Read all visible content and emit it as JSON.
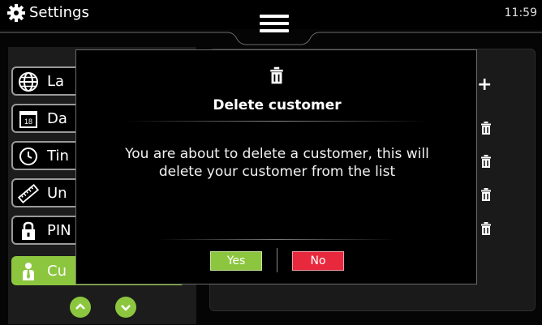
{
  "header": {
    "title": "Settings",
    "time": "11:59",
    "icon": "gear-icon",
    "menu_icon": "hamburger-menu-icon"
  },
  "sidebar": {
    "items": [
      {
        "label": "La",
        "icon": "globe-icon",
        "active": false
      },
      {
        "label": "Da",
        "icon": "calendar-icon",
        "calendar_day": "18",
        "active": false
      },
      {
        "label": "Tin",
        "icon": "clock-icon",
        "active": false
      },
      {
        "label": "Un",
        "icon": "ruler-icon",
        "active": false
      },
      {
        "label": "PIN",
        "icon": "lock-icon",
        "active": false
      },
      {
        "label": "Cu",
        "icon": "customer-icon",
        "active": true
      }
    ],
    "scroll_up_icon": "chevron-up-icon",
    "scroll_down_icon": "chevron-down-icon"
  },
  "customer_list": {
    "add_label": "+",
    "row_icon": "trash-icon",
    "row_count": 4
  },
  "dialog": {
    "icon": "trash-icon",
    "title": "Delete customer",
    "message": "You are about to delete a customer, this will delete your customer from the list",
    "yes_label": "Yes",
    "no_label": "No"
  },
  "colors": {
    "accent_green": "#8cc63f",
    "danger_red": "#e8283c",
    "background": "#050505"
  }
}
